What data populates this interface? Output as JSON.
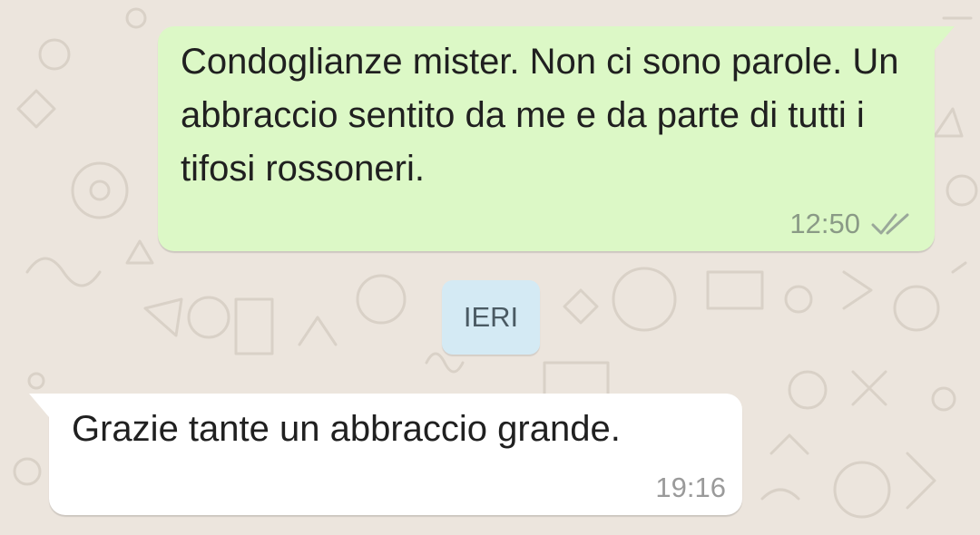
{
  "conversation": {
    "outgoing_message": {
      "text": "Condoglianze mister. Non ci sono parole. Un abbraccio sentito da me e da parte di tutti i tifosi rossoneri.",
      "time": "12:50",
      "status_icon": "double-check-icon"
    },
    "date_divider": {
      "label": "IERI"
    },
    "incoming_message": {
      "text": "Grazie tante un abbraccio grande.",
      "time": "19:16"
    }
  },
  "colors": {
    "background": "#ece5dd",
    "outgoing_bubble": "#dcf8c6",
    "incoming_bubble": "#ffffff",
    "date_pill": "#d4eaf4"
  }
}
